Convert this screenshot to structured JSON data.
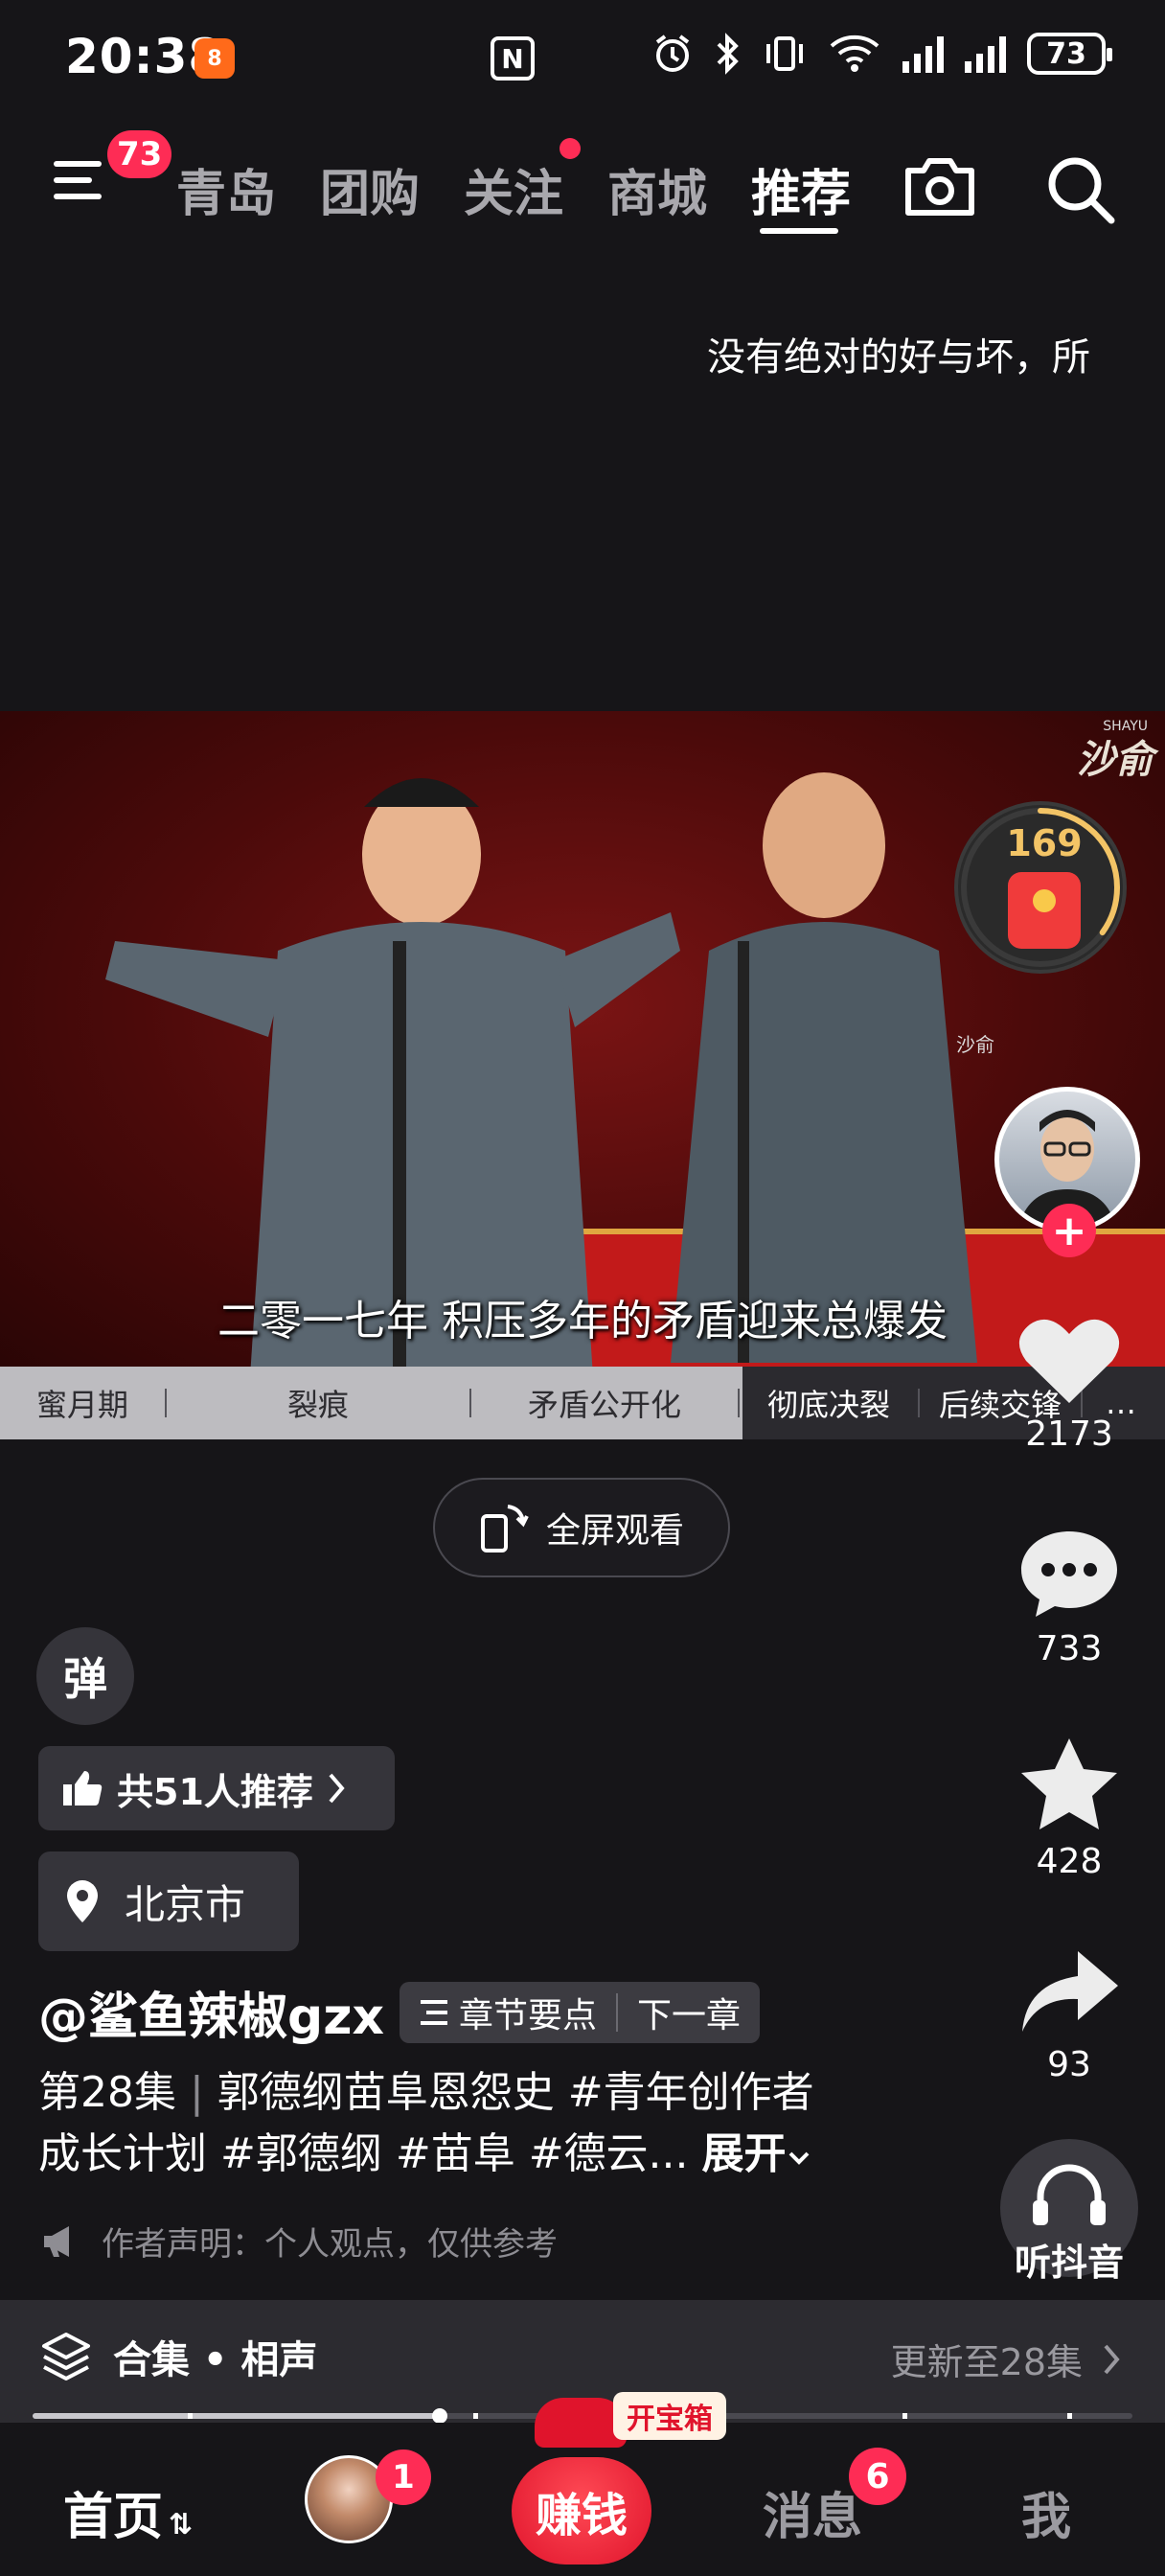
{
  "status_bar": {
    "time": "20:38",
    "app_badge": "8",
    "nfc": "N",
    "battery": "73"
  },
  "top_nav": {
    "menu_badge": "73",
    "tabs": [
      "青岛",
      "团购",
      "关注",
      "商城",
      "推荐"
    ],
    "active_tab": "推荐"
  },
  "caption_scroll": "没有绝对的好与坏，所",
  "video": {
    "watermark": "沙俞",
    "watermark_small": "沙俞",
    "watermark_label": "SHAYU",
    "subtitle": "二零一七年 积压多年的矛盾迎来总爆发"
  },
  "chapters": [
    "蜜月期",
    "裂痕",
    "矛盾公开化",
    "彻底决裂",
    "后续交锋",
    "…"
  ],
  "chapter_progress": 0.637,
  "fullscreen_label": "全屏观看",
  "danmu_label": "弹",
  "recommend_label": "共51人推荐",
  "location_label": "北京市",
  "author": {
    "name": "@鲨鱼辣椒gzx",
    "chapter_points": "章节要点",
    "next_chapter": "下一章"
  },
  "description": {
    "episode": "第28集",
    "title_line1": "郭德纲苗阜恩怨史 #青年创作者",
    "line2": "成长计划 #郭德纲 #苗阜 #德云...",
    "expand": "展开"
  },
  "disclaimer": "作者声明：个人观点，仅供参考",
  "side": {
    "redpacket_count": "169",
    "redpacket_progress": 0.35,
    "likes": "2173",
    "comments": "733",
    "favorites": "428",
    "shares": "93",
    "listen_label": "听抖音"
  },
  "collection": {
    "label": "合集 • 相声",
    "update": "更新至28集"
  },
  "playback_progress": 0.37,
  "bottom_nav": {
    "home": "首页",
    "friend_badge": "1",
    "earn": "赚钱",
    "chest": "开宝箱",
    "messages": "消息",
    "messages_badge": "6",
    "me": "我"
  },
  "colors": {
    "accent": "#fe2c55",
    "background": "#161518",
    "panel": "#35343a",
    "gold": "#f3c466"
  }
}
